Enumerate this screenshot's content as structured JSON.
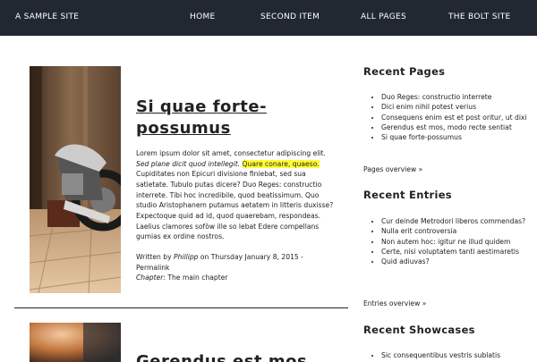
{
  "header": {
    "brand": "A SAMPLE SITE",
    "nav": [
      {
        "label": "HOME"
      },
      {
        "label": "SECOND ITEM"
      },
      {
        "label": "ALL PAGES"
      },
      {
        "label": "THE BOLT SITE"
      }
    ]
  },
  "article": {
    "title": "Si quae forte-possumus",
    "body_part1": "Lorem ipsum dolor sit amet, consectetur adipiscing elit.",
    "body_italic": "Sed plane dicit quod intellegit.",
    "body_highlight": "Quare conare, quaeso.",
    "body_part2": "Cupiditates non Epicuri divisione finiebat, sed sua satietate. Tubulo putas dicere? Duo Reges: constructio interrete. Tibi hoc incredibile, quod beatissimum. Quo studio Aristophanem putamus aetatem in litteris duxisse? Expectoque quid ad id, quod quaerebam, respondeas. Laelius clamores sofòw ille so lebat Edere compellans gumias ex ordine nostros.",
    "written_by": "Written by",
    "author": "Phillipp",
    "date": "on Thursday January 8, 2015 -",
    "permalink": "Permalink",
    "chapter_label": "Chapter:",
    "chapter": "The main chapter",
    "next_title": "Gerendus est mos"
  },
  "sidebar": {
    "recent_pages": {
      "heading": "Recent Pages",
      "items": [
        "Duo Reges: constructio interrete",
        "Dici enim nihil potest verius",
        "Consequens enim est et post oritur, ut dixi",
        "Gerendus est mos, modo recte sentiat",
        "Si quae forte-possumus"
      ],
      "overview": "Pages overview »"
    },
    "recent_entries": {
      "heading": "Recent Entries",
      "items": [
        "Cur deinde Metrodori liberos commendas?",
        "Nulla erit controversia",
        "Non autem hoc: igitur ne illud quidem",
        "Certe, nisi voluptatem tanti aestimaretis",
        "Quid adiuvas?"
      ],
      "overview": "Entries overview »"
    },
    "recent_showcases": {
      "heading": "Recent Showcases",
      "items": [
        "Sic consequentibus vestris sublatis"
      ]
    }
  }
}
